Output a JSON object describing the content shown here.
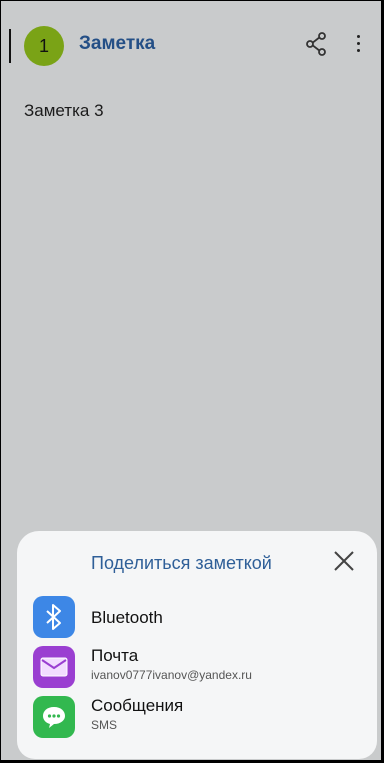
{
  "header": {
    "badge": "1",
    "title": "Заметка"
  },
  "note": {
    "text": "Заметка 3"
  },
  "share_sheet": {
    "title": "Поделиться заметкой",
    "items": [
      {
        "icon": "bluetooth-icon",
        "title": "Bluetooth",
        "subtitle": ""
      },
      {
        "icon": "mail-icon",
        "title": "Почта",
        "subtitle": "ivanov0777ivanov@yandex.ru"
      },
      {
        "icon": "messages-icon",
        "title": "Сообщения",
        "subtitle": "SMS"
      }
    ]
  },
  "colors": {
    "accent": "#2f5f98",
    "badge": "#7aa316",
    "bluetooth": "#3d87e6",
    "mail": "#9a3fd1",
    "messages": "#32b84f"
  }
}
